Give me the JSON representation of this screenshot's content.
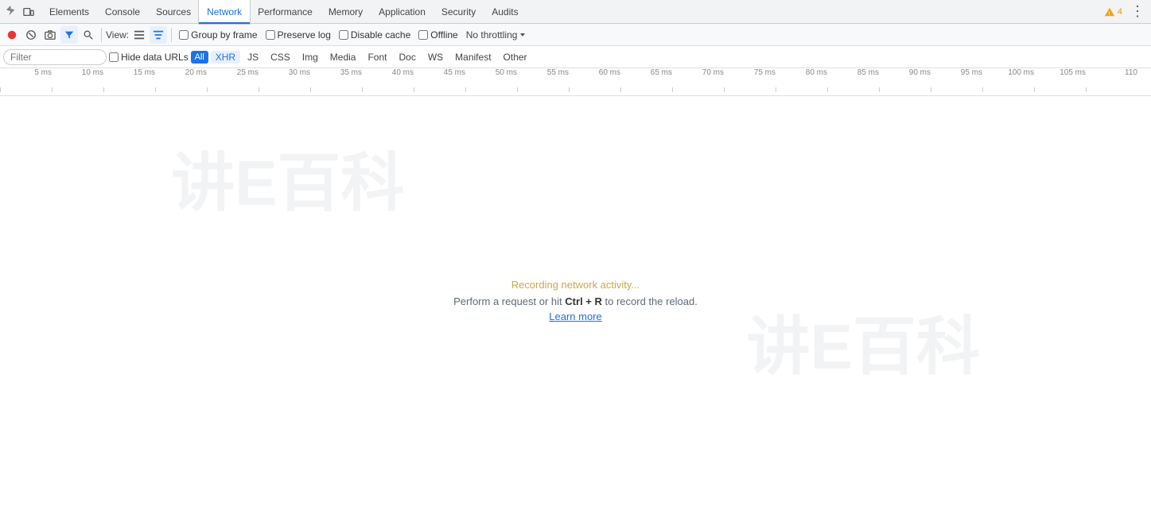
{
  "tabs": {
    "items": [
      {
        "label": "Elements"
      },
      {
        "label": "Console"
      },
      {
        "label": "Sources"
      },
      {
        "label": "Network"
      },
      {
        "label": "Performance"
      },
      {
        "label": "Memory"
      },
      {
        "label": "Application"
      },
      {
        "label": "Security"
      },
      {
        "label": "Audits"
      }
    ],
    "active": "Network",
    "warning_count": "4",
    "more_label": "⋮"
  },
  "toolbar": {
    "view_label": "View:",
    "group_by_frame_label": "Group by frame",
    "preserve_log_label": "Preserve log",
    "disable_cache_label": "Disable cache",
    "offline_label": "Offline",
    "throttling_label": "No throttling"
  },
  "filter": {
    "placeholder": "Filter",
    "hide_data_urls_label": "Hide data URLs",
    "all_label": "All",
    "types": [
      "XHR",
      "JS",
      "CSS",
      "Img",
      "Media",
      "Font",
      "Doc",
      "WS",
      "Manifest",
      "Other"
    ]
  },
  "timeline": {
    "ticks": [
      "5 ms",
      "10 ms",
      "15 ms",
      "20 ms",
      "25 ms",
      "30 ms",
      "35 ms",
      "40 ms",
      "45 ms",
      "50 ms",
      "55 ms",
      "60 ms",
      "65 ms",
      "70 ms",
      "75 ms",
      "80 ms",
      "85 ms",
      "90 ms",
      "95 ms",
      "100 ms",
      "105 ms",
      "110"
    ]
  },
  "message": {
    "recording": "Recording network activity...",
    "perform": "Perform a request or hit",
    "shortcut": "Ctrl + R",
    "perform_end": "to record the reload.",
    "learn_more": "Learn more"
  },
  "watermark": {
    "text1": "讲E百科",
    "text2": "讲E百科"
  }
}
